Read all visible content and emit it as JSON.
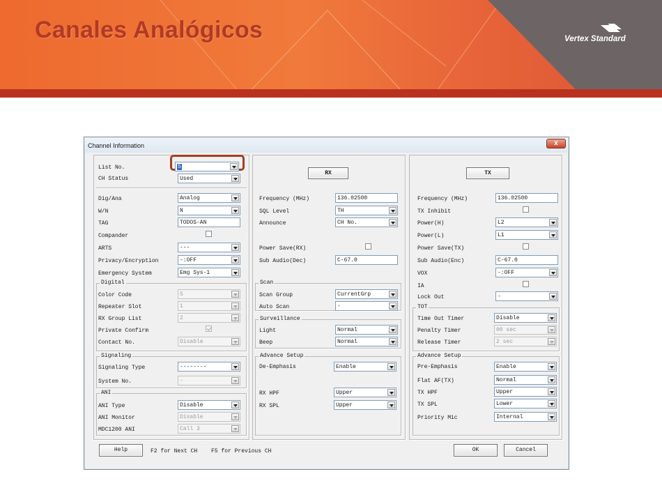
{
  "slide": {
    "title": "Canales Analógicos",
    "logo": "Vertex Standard"
  },
  "window": {
    "title": "Channel Information",
    "close_glyph": "x"
  },
  "left": {
    "list_no": {
      "label": "List No.",
      "value": "5"
    },
    "ch_status": {
      "label": "CH Status",
      "value": "Used"
    },
    "dig_ana": {
      "label": "Dig/Ana",
      "value": "Analog"
    },
    "wn": {
      "label": "W/N",
      "value": "N"
    },
    "tag": {
      "label": "TAG",
      "value": "TODOS-AN"
    },
    "compander": {
      "label": "Compander"
    },
    "arts": {
      "label": "ARTS",
      "value": "---"
    },
    "privacy": {
      "label": "Privacy/Encryption",
      "value": "-:OFF"
    },
    "emergency": {
      "label": "Emergency System",
      "value": "Emg Sys-1"
    },
    "digital": {
      "title": "Digital",
      "color_code": {
        "label": "Color Code",
        "value": "5"
      },
      "repeater_slot": {
        "label": "Repeater Slot",
        "value": "1"
      },
      "rx_group_list": {
        "label": "RX Group List",
        "value": "2"
      },
      "private_confirm": {
        "label": "Private Confirm"
      },
      "contact_no": {
        "label": "Contact No.",
        "value": "Disable"
      }
    },
    "signaling": {
      "title": "Signaling",
      "type": {
        "label": "Signaling Type",
        "value": "--------"
      },
      "system_no": {
        "label": "System No.",
        "value": "-"
      }
    },
    "ani": {
      "title": "ANI",
      "type": {
        "label": "ANI Type",
        "value": "Disable"
      },
      "monitor": {
        "label": "ANI Monitor",
        "value": "Disable"
      },
      "mdc": {
        "label": "MDC1200 ANI",
        "value": "Call 3"
      }
    }
  },
  "rx": {
    "header": "RX",
    "frequency": {
      "label": "Frequency (MHz)",
      "value": "136.02500"
    },
    "sql_level": {
      "label": "SQL Level",
      "value": "TH"
    },
    "announce": {
      "label": "Announce",
      "value": "CH No."
    },
    "power_save": {
      "label": "Power Save(RX)"
    },
    "sub_audio": {
      "label": "Sub Audio(Dec)",
      "value": "C-67.0"
    },
    "scan": {
      "title": "Scan",
      "group": {
        "label": "Scan Group",
        "value": "CurrentGrp"
      },
      "auto": {
        "label": "Auto Scan",
        "value": "-"
      }
    },
    "surveillance": {
      "title": "Surveillance",
      "light": {
        "label": "Light",
        "value": "Normal"
      },
      "beep": {
        "label": "Beep",
        "value": "Normal"
      }
    },
    "advance": {
      "title": "Advance Setup",
      "de_emphasis": {
        "label": "De-Emphasis",
        "value": "Enable"
      },
      "rx_hpf": {
        "label": "RX HPF",
        "value": "Upper"
      },
      "rx_spl": {
        "label": "RX SPL",
        "value": "Upper"
      }
    }
  },
  "tx": {
    "header": "TX",
    "frequency": {
      "label": "Frequency (MHz)",
      "value": "136.02500"
    },
    "inhibit": {
      "label": "TX Inhibit"
    },
    "power_h": {
      "label": "Power(H)",
      "value": "L2"
    },
    "power_l": {
      "label": "Power(L)",
      "value": "L1"
    },
    "power_save": {
      "label": "Power Save(TX)"
    },
    "sub_audio": {
      "label": "Sub Audio(Enc)",
      "value": "C-67.0"
    },
    "vox": {
      "label": "VOX",
      "value": "-:OFF"
    },
    "ia": {
      "label": "IA"
    },
    "lock_out": {
      "label": "Lock Out",
      "value": "-"
    },
    "tot": {
      "title": "TOT",
      "timer": {
        "label": "Time Out Timer",
        "value": "Disable"
      },
      "penalty": {
        "label": "Penalty Timer",
        "value": "00 sec"
      },
      "release": {
        "label": "Release Timer",
        "value": "2 sec"
      }
    },
    "advance": {
      "title": "Advance Setup",
      "pre_emphasis": {
        "label": "Pre-Emphasis",
        "value": "Enable"
      },
      "flat_af": {
        "label": "Flat AF(TX)",
        "value": "Normal"
      },
      "tx_hpf": {
        "label": "TX HPF",
        "value": "Upper"
      },
      "tx_spl": {
        "label": "TX SPL",
        "value": "Lower"
      },
      "priority_mic": {
        "label": "Priority Mic",
        "value": "Internal"
      }
    }
  },
  "footer": {
    "help": "Help",
    "hint_next": "F2 for Next CH",
    "hint_prev": "F5 for Previous CH",
    "ok": "OK",
    "cancel": "Cancel"
  },
  "colors": {
    "banner_orange": "#ee6a2f",
    "banner_dark": "#b8321f",
    "title_text": "#b23a24",
    "highlight": "#a5401f"
  }
}
